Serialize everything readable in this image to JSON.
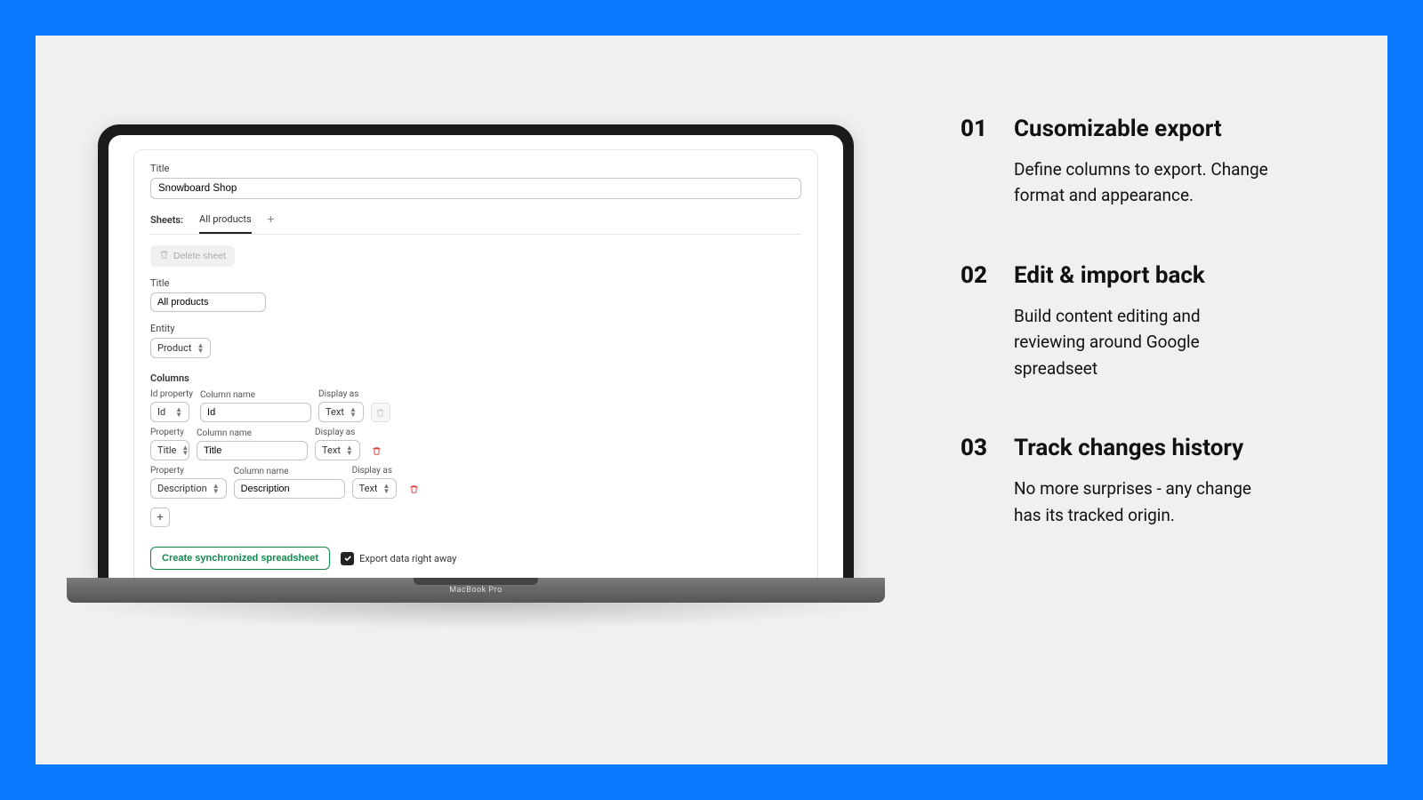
{
  "form": {
    "title_label": "Title",
    "title_value": "Snowboard Shop",
    "sheets_label": "Sheets:",
    "tabs": [
      "All products"
    ],
    "delete_sheet_label": "Delete sheet",
    "sheet_title_label": "Title",
    "sheet_title_value": "All products",
    "entity_label": "Entity",
    "entity_value": "Product",
    "columns_heading": "Columns",
    "column_headers": {
      "id_property": "Id property",
      "property": "Property",
      "column_name": "Column name",
      "display_as": "Display as"
    },
    "columns": [
      {
        "is_id": true,
        "property": "Id",
        "column_name": "Id",
        "display_as": "Text",
        "deletable": false
      },
      {
        "is_id": false,
        "property": "Title",
        "column_name": "Title",
        "display_as": "Text",
        "deletable": true
      },
      {
        "is_id": false,
        "property": "Description",
        "column_name": "Description",
        "display_as": "Text",
        "deletable": true
      }
    ],
    "create_button": "Create synchronized spreadsheet",
    "export_checkbox_label": "Export data right away",
    "export_checked": true
  },
  "features": [
    {
      "num": "01",
      "title": "Cusomizable export",
      "desc": "Define columns to export. Change format and appearance."
    },
    {
      "num": "02",
      "title": "Edit & import back",
      "desc": "Build content editing and reviewing around Google spreadseet"
    },
    {
      "num": "03",
      "title": "Track changes history",
      "desc": "No more surprises - any change has its tracked origin."
    }
  ],
  "laptop_brand": "MacBook Pro"
}
